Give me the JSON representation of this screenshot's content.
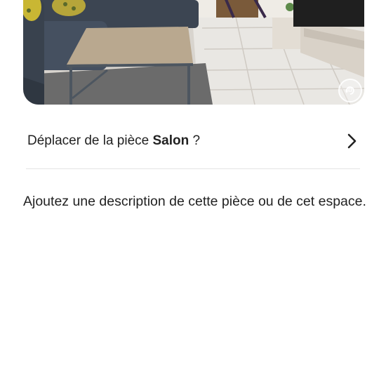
{
  "photo": {
    "alt_subject": "living-room",
    "badge_icon": "rotate-photo-icon"
  },
  "move_row": {
    "prefix": "Déplacer de la pièce ",
    "room_name": "Salon",
    "suffix": " ?",
    "chevron_icon": "chevron-right-icon"
  },
  "description": {
    "text": "Ajoutez une description de cette pièce ou de cet espace."
  },
  "colors": {
    "text": "#222222",
    "divider": "#e4e4e4",
    "background": "#ffffff"
  }
}
